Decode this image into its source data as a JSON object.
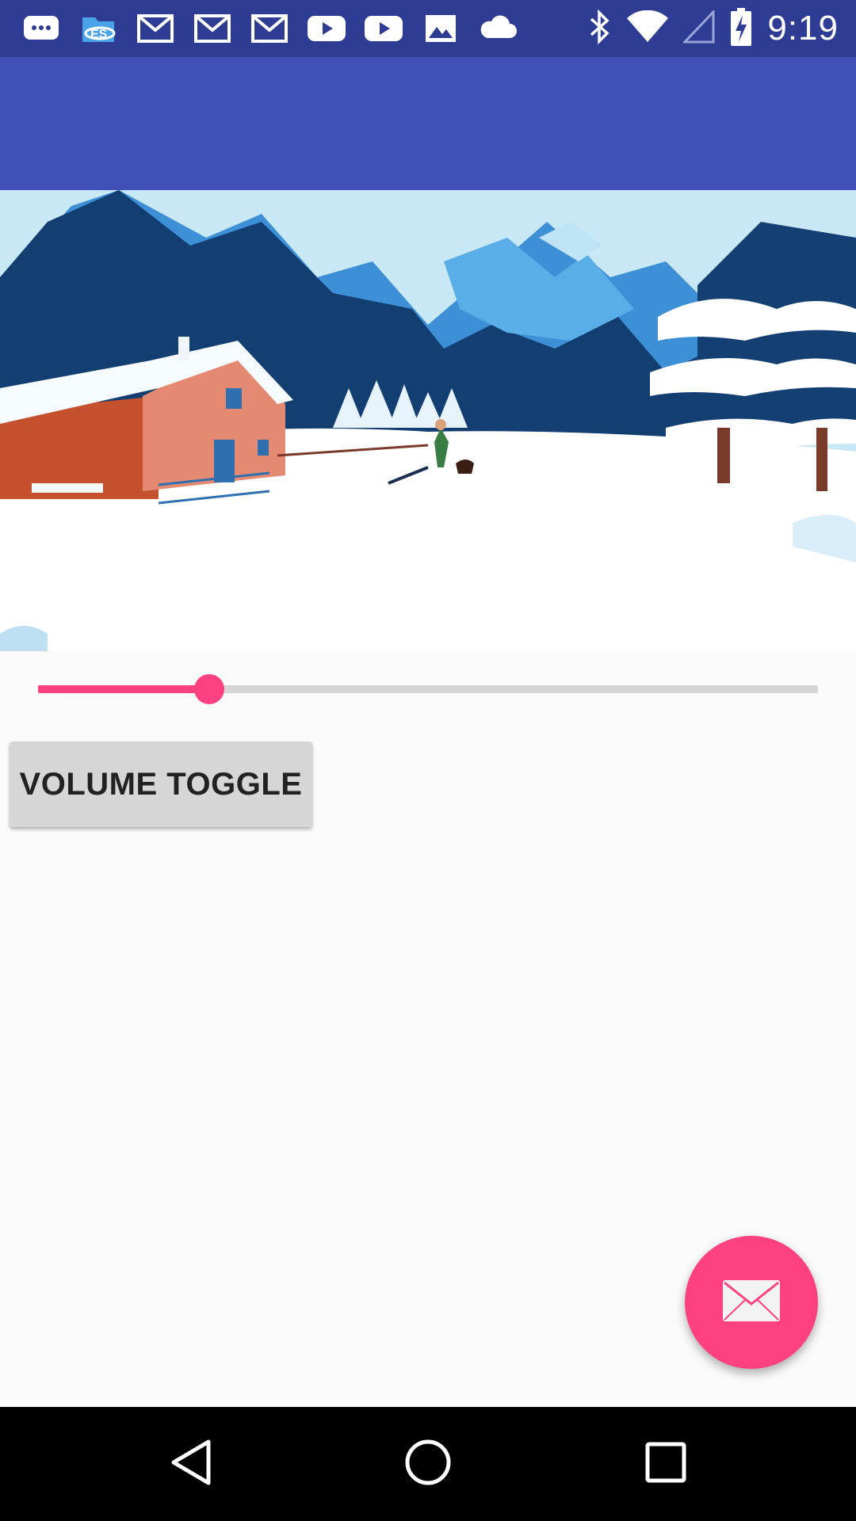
{
  "status_bar": {
    "time": "9:19",
    "background": "#2f3c94",
    "left_icons": [
      "chat-icon",
      "es-file-explorer-icon",
      "gmail-icon",
      "gmail-icon",
      "gmail-icon",
      "youtube-icon",
      "youtube-icon",
      "image-icon",
      "cloud-icon"
    ],
    "right_icons": [
      "bluetooth-icon",
      "wifi-icon",
      "cell-signal-icon",
      "battery-charging-icon"
    ]
  },
  "app_bar": {
    "color": "#3f51b5"
  },
  "video": {
    "scene": "snowy-village-video-frame"
  },
  "seekbar": {
    "progress": 0.22,
    "accent_color": "#ff4081",
    "track_color": "#d6d6d6"
  },
  "volume_button": {
    "label": "VOLUME TOGGLE"
  },
  "fab": {
    "icon": "mail-icon",
    "color": "#ff4081"
  },
  "nav_bar": {
    "buttons": [
      "back-icon",
      "home-icon",
      "recents-icon"
    ]
  }
}
